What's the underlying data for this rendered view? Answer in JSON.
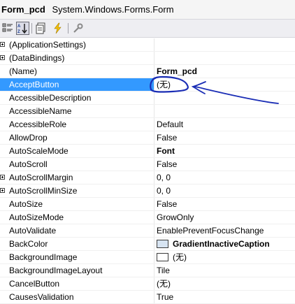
{
  "header": {
    "object_name": "Form_pcd",
    "object_type": "System.Windows.Forms.Form"
  },
  "toolbar": {
    "buttons": [
      {
        "icon": "categorized-icon",
        "active": false
      },
      {
        "icon": "alphabetical-sort-icon",
        "active": true
      },
      {
        "icon": "properties-icon",
        "active": false
      },
      {
        "icon": "events-lightning-icon",
        "active": false
      },
      {
        "icon": "property-pages-wrench-icon",
        "active": false
      }
    ]
  },
  "properties": [
    {
      "name": "(ApplicationSettings)",
      "value": "",
      "expandable": true
    },
    {
      "name": "(DataBindings)",
      "value": "",
      "expandable": true
    },
    {
      "name": "(Name)",
      "value": "Form_pcd",
      "bold": true
    },
    {
      "name": "AcceptButton",
      "value": "(无)",
      "selected": true
    },
    {
      "name": "AccessibleDescription",
      "value": ""
    },
    {
      "name": "AccessibleName",
      "value": ""
    },
    {
      "name": "AccessibleRole",
      "value": "Default"
    },
    {
      "name": "AllowDrop",
      "value": "False"
    },
    {
      "name": "AutoScaleMode",
      "value": "Font",
      "bold": true
    },
    {
      "name": "AutoScroll",
      "value": "False"
    },
    {
      "name": "AutoScrollMargin",
      "value": "0, 0",
      "expandable": true
    },
    {
      "name": "AutoScrollMinSize",
      "value": "0, 0",
      "expandable": true
    },
    {
      "name": "AutoSize",
      "value": "False"
    },
    {
      "name": "AutoSizeMode",
      "value": "GrowOnly"
    },
    {
      "name": "AutoValidate",
      "value": "EnablePreventFocusChange"
    },
    {
      "name": "BackColor",
      "value": "GradientInactiveCaption",
      "bold": true,
      "swatch": "#d7e4f2"
    },
    {
      "name": "BackgroundImage",
      "value": "(无)",
      "swatch": "#ffffff"
    },
    {
      "name": "BackgroundImageLayout",
      "value": "Tile"
    },
    {
      "name": "CancelButton",
      "value": "(无)"
    },
    {
      "name": "CausesValidation",
      "value": "True"
    }
  ],
  "colors": {
    "selection": "#3399ff",
    "annotation_ink": "#1a2db5"
  }
}
